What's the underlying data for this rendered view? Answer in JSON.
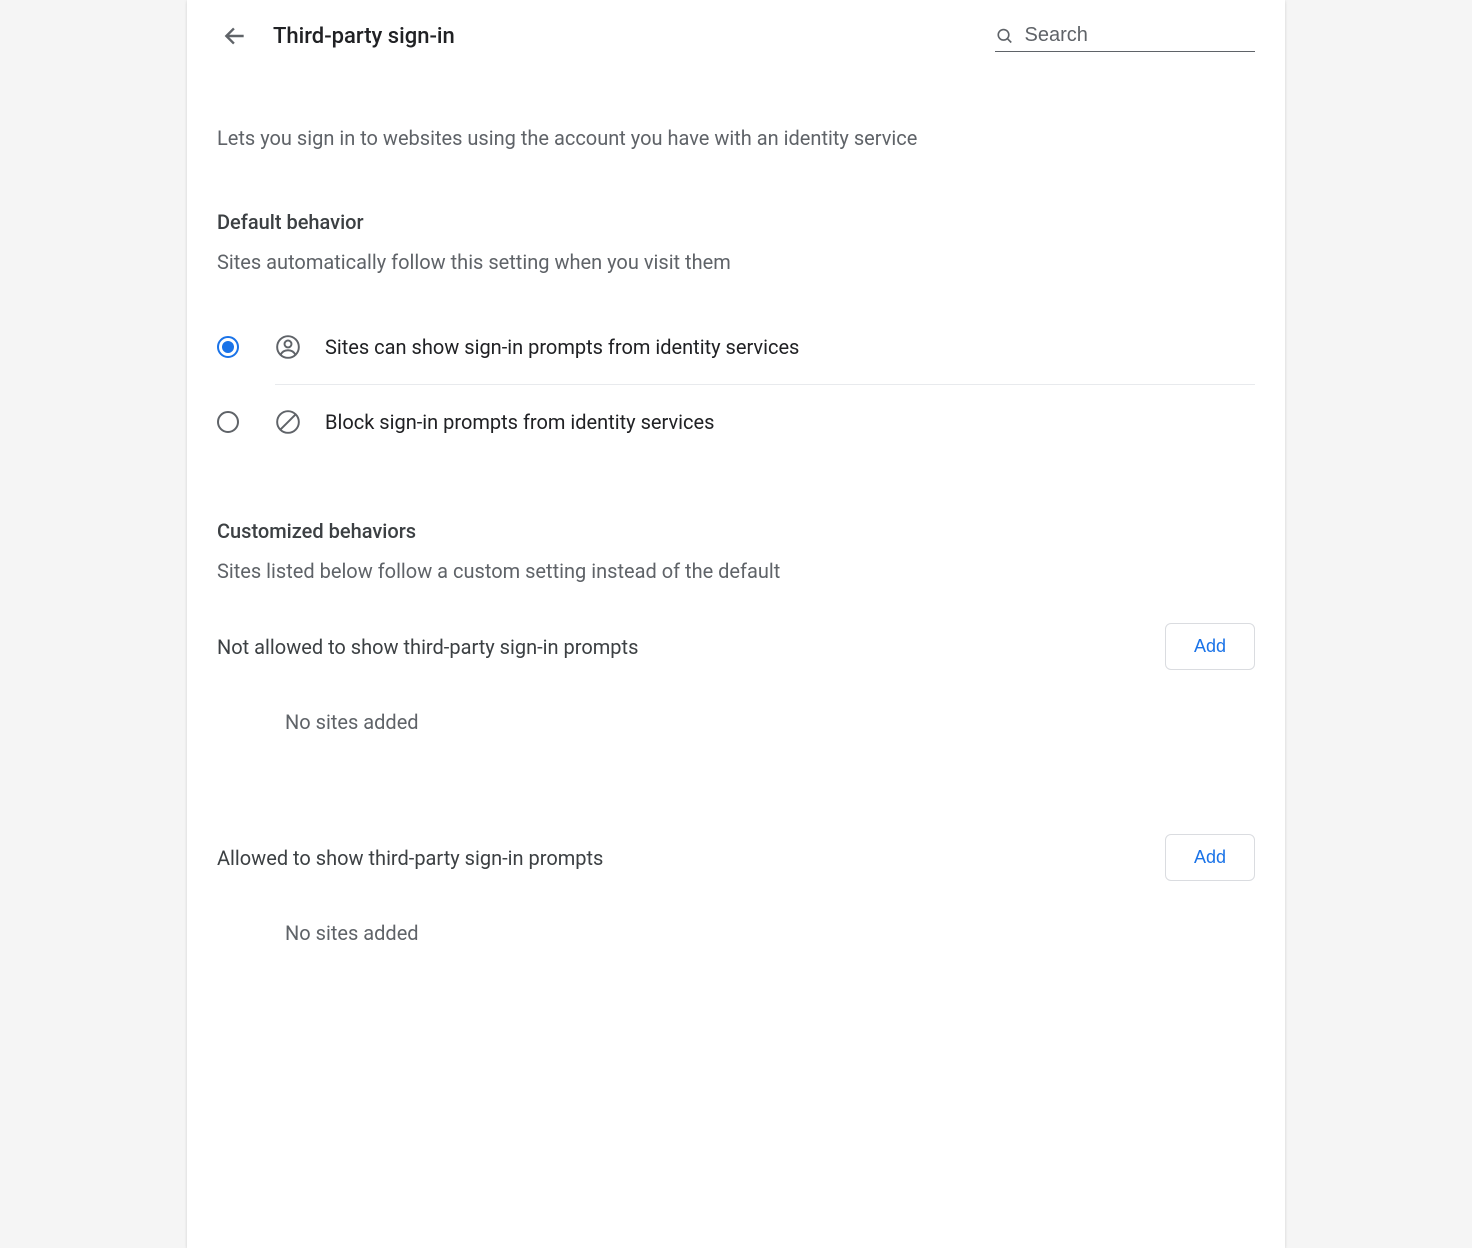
{
  "header": {
    "title": "Third-party sign-in",
    "search_placeholder": "Search"
  },
  "intro": "Lets you sign in to websites using the account you have with an identity service",
  "default_behavior": {
    "heading": "Default behavior",
    "sub": "Sites automatically follow this setting when you visit them",
    "options": [
      {
        "label": "Sites can show sign-in prompts from identity services",
        "selected": true,
        "icon": "account-circle-icon"
      },
      {
        "label": "Block sign-in prompts from identity services",
        "selected": false,
        "icon": "block-icon"
      }
    ]
  },
  "customized": {
    "heading": "Customized behaviors",
    "sub": "Sites listed below follow a custom setting instead of the default",
    "not_allowed": {
      "label": "Not allowed to show third-party sign-in prompts",
      "add_label": "Add",
      "empty": "No sites added"
    },
    "allowed": {
      "label": "Allowed to show third-party sign-in prompts",
      "add_label": "Add",
      "empty": "No sites added"
    }
  }
}
